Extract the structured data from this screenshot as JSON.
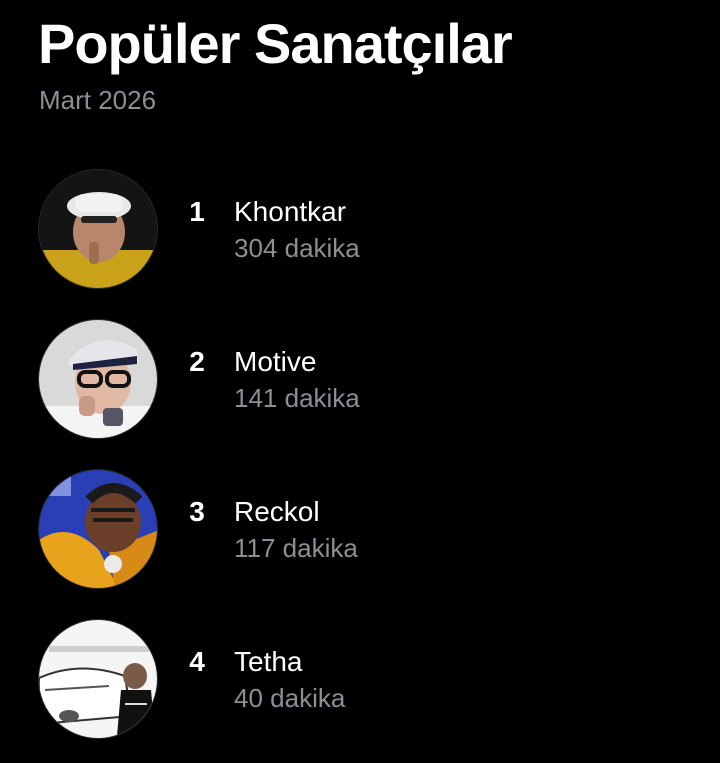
{
  "header": {
    "title": "Popüler Sanatçılar",
    "subtitle": "Mart 2026"
  },
  "artists": [
    {
      "rank": "1",
      "name": "Khontkar",
      "minutes": "304 dakika",
      "avatar_icon": "artist-photo-icon"
    },
    {
      "rank": "2",
      "name": "Motive",
      "minutes": "141 dakika",
      "avatar_icon": "artist-photo-icon"
    },
    {
      "rank": "3",
      "name": "Reckol",
      "minutes": "117 dakika",
      "avatar_icon": "artist-photo-icon"
    },
    {
      "rank": "4",
      "name": "Tetha",
      "minutes": "40 dakika",
      "avatar_icon": "artist-photo-icon"
    }
  ],
  "colors": {
    "background": "#000000",
    "primary_text": "#ffffff",
    "secondary_text": "#8e8e93"
  }
}
